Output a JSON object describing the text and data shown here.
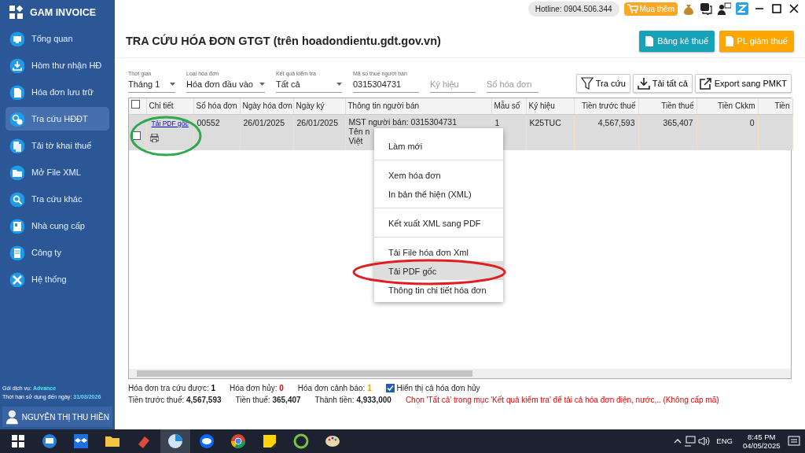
{
  "app": {
    "logo": "GAM INVOICE"
  },
  "sidebar": {
    "items": [
      {
        "label": "Tổng quan",
        "selected": false
      },
      {
        "label": "Hòm thư nhận HĐ",
        "selected": false
      },
      {
        "label": "Hóa đơn lưu trữ",
        "selected": false
      },
      {
        "label": "Tra cứu HĐĐT",
        "selected": true
      },
      {
        "label": "Tải tờ khai thuế",
        "selected": false
      },
      {
        "label": "Mở File XML",
        "selected": false
      },
      {
        "label": "Tra cứu khác",
        "selected": false
      },
      {
        "label": "Nhà cung cấp",
        "selected": false
      },
      {
        "label": "Công ty",
        "selected": false
      },
      {
        "label": "Hệ thống",
        "selected": false
      }
    ]
  },
  "account": {
    "service_label": "Gói dịch vụ:",
    "service": "Advance",
    "expiry_label": "Thời hạn sử dụng đến ngày:",
    "expiry": "31/03/2026",
    "user": "NGUYỄN THỊ THU HIỀN"
  },
  "topbar": {
    "hotline": "Hotline: 0904.506.344",
    "buy_button": "Mua thêm"
  },
  "page_title": "TRA CỨU HÓA ĐƠN GTGT (trên hoadondientu.gdt.gov.vn)",
  "action_buttons": [
    {
      "label": "Bảng kê thuế",
      "color": "#17a2b8"
    },
    {
      "label": "PL giảm thuế",
      "color": "#ffa500"
    }
  ],
  "filters": [
    {
      "kind": "select",
      "label": "Thời gian",
      "value": "Tháng 1"
    },
    {
      "kind": "select",
      "label": "Loại hóa đơn",
      "value": "Hóa đơn đầu vào"
    },
    {
      "kind": "select",
      "label": "Kết quả kiểm tra",
      "value": "Tất cả"
    },
    {
      "kind": "input",
      "label": "Mã số thuế người bán",
      "value": "0315304731"
    },
    {
      "kind": "input",
      "placeholder": "Ký hiệu"
    },
    {
      "kind": "input",
      "placeholder": "Số hóa đơn"
    }
  ],
  "toolbar": [
    {
      "kind": "search",
      "label": "Tra cứu"
    },
    {
      "kind": "download",
      "label": "Tải tất cả"
    },
    {
      "kind": "export",
      "label": "Export sang PMKT"
    }
  ],
  "table": {
    "header_checked": false,
    "columns": [
      "Chi tiết",
      "Số hóa đơn",
      "Ngày hóa đơn",
      "Ngày ký",
      "Thông tin người bán",
      "Mẫu số",
      "Ký hiệu",
      "Tiền trước thuế",
      "Tiền thuế",
      "Tiền Ckkm",
      "Tiền"
    ],
    "rows": [
      {
        "checked": false,
        "selected": true,
        "detail_link": "Tải PDF gốc",
        "invoice_no": "00552",
        "invoice_date": "26/01/2025",
        "sign_date": "26/01/2025",
        "seller_lines": [
          "MST người bán: 0315304731",
          "Tên n",
          "Việt"
        ],
        "form_no": "1",
        "symbol": "K25TUC",
        "pre_tax": "4,567,593",
        "tax": "365,407",
        "discount": "0"
      }
    ]
  },
  "context_menu": {
    "groups": [
      [
        {
          "label": "Làm mới",
          "selected": false
        }
      ],
      [
        {
          "label": "Xem hóa đơn",
          "selected": false
        },
        {
          "label": "In bản thể hiện (XML)",
          "selected": false
        }
      ],
      [
        {
          "label": "Kết xuất XML sang PDF",
          "selected": false
        }
      ],
      [
        {
          "label": "Tải File hóa đơn Xml",
          "selected": false
        },
        {
          "label": "Tải PDF gốc",
          "selected": true
        },
        {
          "label": "Thông tin chi tiết hóa đơn",
          "selected": false
        }
      ]
    ]
  },
  "summary": {
    "line1": [
      {
        "label": "Hóa đơn tra cứu được:",
        "value": "1",
        "color": "#000000"
      },
      {
        "label": "Hóa đơn hủy:",
        "value": "0",
        "color": "#ff0000"
      },
      {
        "label": "Hóa đơn cảnh báo:",
        "value": "1",
        "color": "#f5a000"
      }
    ],
    "show_cancelled": {
      "label": "Hiển thị cả hóa đơn hủy",
      "checked": true
    },
    "line2": [
      {
        "label": "Tiền trước thuế:",
        "value": "4,567,593"
      },
      {
        "label": "Tiền thuế:",
        "value": "365,407"
      },
      {
        "label": "Thành tiền:",
        "value": "4,933,000"
      }
    ],
    "note": "Chọn 'Tất cả' trong mục 'Kết quả kiểm tra' để tải cả hóa đơn điện, nước,.. (Không cấp mã)"
  },
  "taskbar": {
    "language": "ENG",
    "time": "8:45 PM",
    "date": "04/05/2025"
  }
}
